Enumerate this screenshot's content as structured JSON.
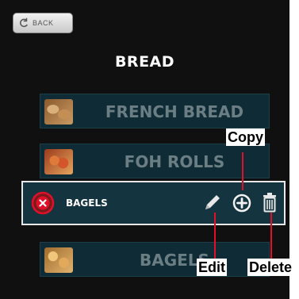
{
  "header": {
    "back_label": "BACK",
    "title": "BREAD"
  },
  "items": [
    {
      "label": "FRENCH BREAD",
      "thumb": "french-bread-photo"
    },
    {
      "label": "FOH ROLLS",
      "thumb": "foh-rolls-photo"
    },
    {
      "label": "BAGELS",
      "thumb": "bagels-photo"
    }
  ],
  "selected_item": {
    "label": "BAGELS",
    "actions": {
      "delete_circle": "x-circle-icon",
      "edit": "pencil-icon",
      "copy": "plus-circle-icon",
      "delete": "trash-icon"
    }
  },
  "callouts": {
    "copy": "Copy",
    "edit": "Edit",
    "delete": "Delete"
  },
  "colors": {
    "background": "#101010",
    "row": "#0f2c36",
    "row_text": "#6b7e84",
    "accent_red": "#e0102a"
  }
}
